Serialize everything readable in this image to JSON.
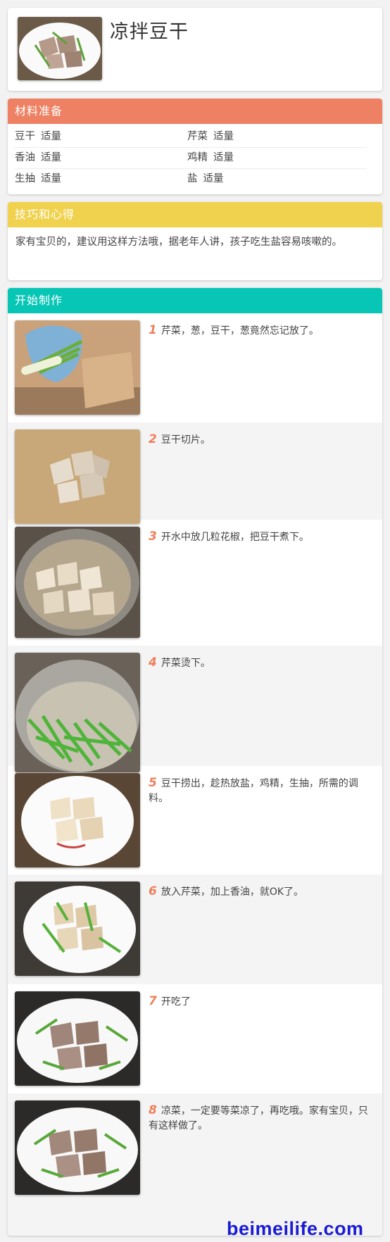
{
  "recipe": {
    "title": "凉拌豆干"
  },
  "ingredients": {
    "heading": "材料准备",
    "color": "#ee8063",
    "rows": [
      [
        {
          "name": "豆干",
          "amount": "适量"
        },
        {
          "name": "芹菜",
          "amount": "适量"
        }
      ],
      [
        {
          "name": "香油",
          "amount": "适量"
        },
        {
          "name": "鸡精",
          "amount": "适量"
        }
      ],
      [
        {
          "name": "生抽",
          "amount": "适量"
        },
        {
          "name": "盐",
          "amount": "适量"
        }
      ]
    ]
  },
  "tips": {
    "heading": "技巧和心得",
    "color": "#f0d24f",
    "text": "家有宝贝的，建议用这样方法哦，据老年人讲，孩子吃生盐容易咳嗽的。"
  },
  "steps": {
    "heading": "开始制作",
    "color": "#08c6b6",
    "items": [
      {
        "num": "1",
        "text": "芹菜，葱，豆干，葱竟然忘记放了。",
        "image": "celery-tofu-ingredients-photo"
      },
      {
        "num": "2",
        "text": "豆干切片。",
        "image": "sliced-tofu-photo"
      },
      {
        "num": "3",
        "text": "开水中放几粒花椒，把豆干煮下。",
        "image": "boiling-tofu-photo"
      },
      {
        "num": "4",
        "text": "芹菜烫下。",
        "image": "blanching-celery-photo"
      },
      {
        "num": "5",
        "text": "豆干捞出，趁热放盐，鸡精，生抽，所需的调料。",
        "image": "seasoned-tofu-photo"
      },
      {
        "num": "6",
        "text": "放入芹菜，加上香油，就OK了。",
        "image": "mixed-dish-photo"
      },
      {
        "num": "7",
        "text": "开吃了",
        "image": "plated-dish-photo"
      },
      {
        "num": "8",
        "text": "凉菜，一定要等菜凉了，再吃哦。家有宝贝，只有这样做了。",
        "image": "final-dish-photo"
      }
    ]
  },
  "watermark": "beimeilife.com"
}
